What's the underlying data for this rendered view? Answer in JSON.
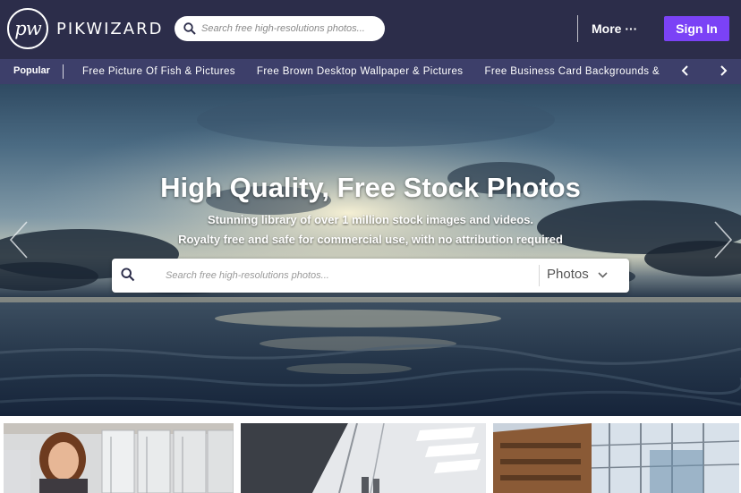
{
  "header": {
    "logo_mark": "pw",
    "logo_text": "PIKWIZARD",
    "search_placeholder": "Search free high-resolutions photos...",
    "more_label": "More ···",
    "signin_label": "Sign In",
    "accent_color": "#7b42f6",
    "background_color": "#2c2d4a"
  },
  "popular": {
    "label": "Popular",
    "links": [
      "Free Picture Of Fish & Pictures",
      "Free Brown Desktop Wallpaper & Pictures",
      "Free Business Card Backgrounds &"
    ],
    "prev_icon": "chevron-left-icon",
    "next_icon": "chevron-right-icon",
    "background_color": "#3d3f6a"
  },
  "hero": {
    "title": "High Quality, Free Stock Photos",
    "subtitle_1": "Stunning library of over 1 million stock images and videos.",
    "subtitle_2": "Royalty free and safe for commercial use, with no attribution required",
    "search_placeholder": "Search free high-resolutions photos...",
    "media_type": "Photos"
  },
  "thumbnails": [
    {
      "subject": "woman-in-server-room"
    },
    {
      "subject": "modern-interior-skylight"
    },
    {
      "subject": "glass-office-building"
    }
  ]
}
